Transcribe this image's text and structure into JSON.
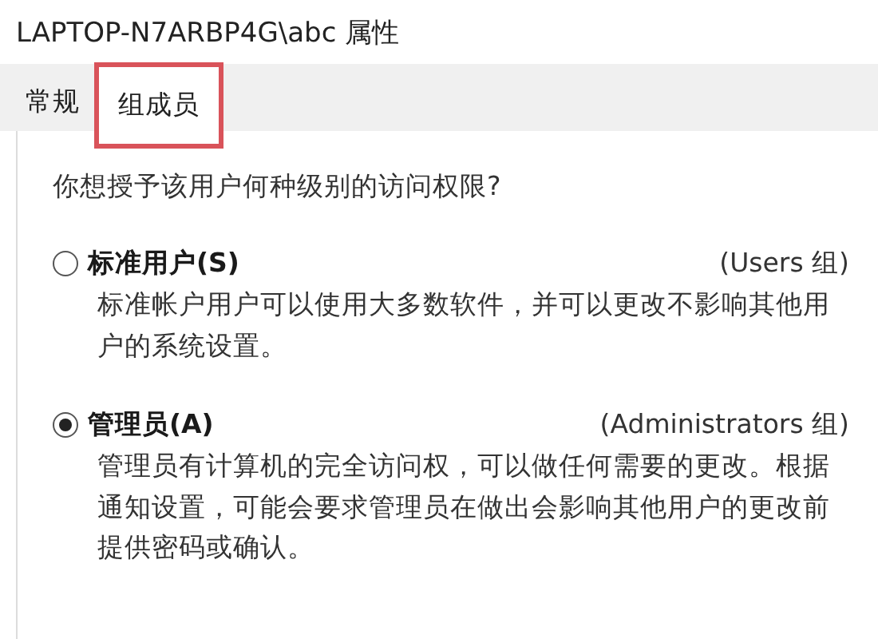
{
  "window": {
    "title": "LAPTOP-N7ARBP4G\\abc 属性"
  },
  "tabs": [
    {
      "label": "常规",
      "selected": false,
      "highlighted": false
    },
    {
      "label": "组成员",
      "selected": true,
      "highlighted": true
    }
  ],
  "question": "你想授予该用户何种级别的访问权限?",
  "options": [
    {
      "label": "标准用户(S)",
      "group": "(Users 组)",
      "description": "标准帐户用户可以使用大多数软件，并可以更改不影响其他用户的系统设置。",
      "selected": false
    },
    {
      "label": "管理员(A)",
      "group": "(Administrators 组)",
      "description": "管理员有计算机的完全访问权，可以做任何需要的更改。根据通知设置，可能会要求管理员在做出会影响其他用户的更改前提供密码或确认。",
      "selected": true
    }
  ]
}
